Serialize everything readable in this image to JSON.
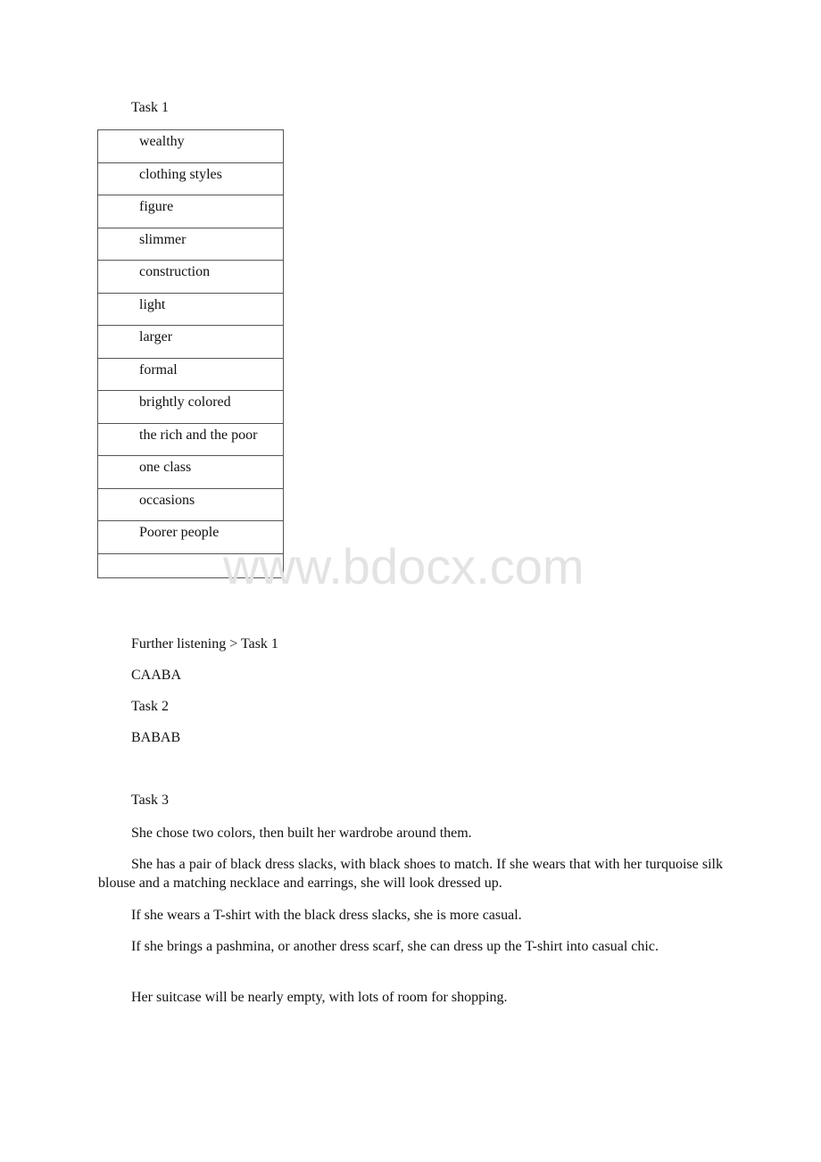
{
  "task1": {
    "heading": "Task 1",
    "answers": [
      "wealthy",
      "clothing styles",
      "figure",
      "slimmer",
      "construction",
      "light",
      "larger",
      "formal",
      "brightly colored",
      "the rich and the poor",
      "one class",
      "occasions",
      "Poorer people",
      ""
    ]
  },
  "watermark": "www.bdocx.com",
  "further_listening": {
    "heading": "Further listening > Task 1",
    "task1_answer": "CAABA",
    "task2_heading": "Task 2",
    "task2_answer": "BABAB",
    "task3_heading": "Task 3",
    "task3_paragraphs": [
      "She chose two colors, then built her wardrobe around them.",
      "She has a pair of black dress slacks, with black shoes to match. If she wears that with her turquoise silk blouse and a matching necklace and earrings, she will look dressed up.",
      "If she wears a T-shirt with the black dress slacks, she is more casual.",
      "If she brings a pashmina, or another dress scarf, she can dress up the T-shirt into casual chic.",
      "Her suitcase will be nearly empty, with lots of room for shopping."
    ]
  }
}
